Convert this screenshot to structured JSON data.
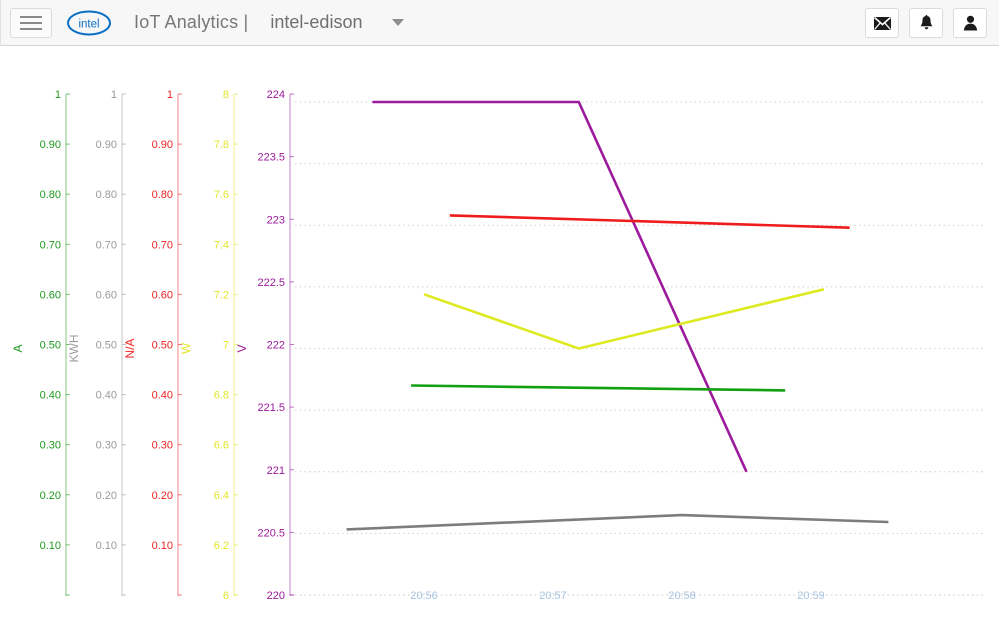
{
  "header": {
    "menu_icon": "hamburger-menu-icon",
    "logo_text": "intel",
    "app_title": "IoT Analytics |",
    "device_name": "intel-edison",
    "caret_icon": "chevron-down-icon",
    "actions": [
      {
        "name": "messages-button",
        "icon": "envelope-icon",
        "glyph": "✉"
      },
      {
        "name": "notifications-button",
        "icon": "bell-icon",
        "glyph": "🔔"
      },
      {
        "name": "account-button",
        "icon": "person-icon",
        "glyph": "👤"
      }
    ]
  },
  "chart_data": {
    "type": "line",
    "title": "",
    "xlabel": "",
    "grid": true,
    "legend": "none",
    "x_axis": {
      "ticks": [
        "20:56",
        "20:57",
        "20:58",
        "20:59"
      ],
      "tick_color": "#a8c4e0",
      "range": [
        "20:55",
        "21:00"
      ]
    },
    "y_axes": [
      {
        "label": "A",
        "color": "#1f9b1f",
        "ticks": [
          "1",
          "0.90",
          "0.80",
          "0.70",
          "0.60",
          "0.50",
          "0.40",
          "0.30",
          "0.20",
          "0.10"
        ],
        "min": 0,
        "max": 1
      },
      {
        "label": "KWH",
        "color": "#9a9a9a",
        "ticks": [
          "1",
          "0.90",
          "0.80",
          "0.70",
          "0.60",
          "0.50",
          "0.40",
          "0.30",
          "0.20",
          "0.10"
        ],
        "min": 0,
        "max": 1
      },
      {
        "label": "N/A",
        "color": "#ef2323",
        "ticks": [
          "1",
          "0.90",
          "0.80",
          "0.70",
          "0.60",
          "0.50",
          "0.40",
          "0.30",
          "0.20",
          "0.10"
        ],
        "min": 0,
        "max": 1
      },
      {
        "label": "W",
        "color": "#e2e62a",
        "ticks": [
          "8",
          "7.8",
          "7.6",
          "7.4",
          "7.2",
          "7",
          "6.8",
          "6.6",
          "6.4",
          "6.2",
          "6"
        ],
        "min": 6,
        "max": 8
      },
      {
        "label": "V",
        "color": "#9c1a9c",
        "ticks": [
          "224",
          "223.5",
          "223",
          "222.5",
          "222",
          "221.5",
          "221",
          "220.5",
          "220"
        ],
        "min": 220,
        "max": 224
      }
    ],
    "series": [
      {
        "name": "V",
        "axis": "V",
        "color": "#9c1a9c",
        "x": [
          "20:55.6",
          "20:57.2",
          "20:58.5"
        ],
        "values": [
          224.0,
          224.0,
          221.0
        ]
      },
      {
        "name": "N/A",
        "axis": "N/A",
        "color": "#ee1c1c",
        "x": [
          "20:56.2",
          "20:59.3"
        ],
        "values": [
          0.77,
          0.745
        ]
      },
      {
        "name": "W",
        "axis": "W",
        "color": "#ddea22",
        "x": [
          "20:56.0",
          "20:57.2",
          "20:59.1"
        ],
        "values": [
          7.22,
          7.0,
          7.24
        ]
      },
      {
        "name": "A",
        "axis": "A",
        "color": "#11a011",
        "x": [
          "20:55.9",
          "20:58.8"
        ],
        "values": [
          0.425,
          0.415
        ]
      },
      {
        "name": "KWH",
        "axis": "KWH",
        "color": "#7d7d7d",
        "x": [
          "20:55.4",
          "20:58.0",
          "20:59.6"
        ],
        "values": [
          0.133,
          0.162,
          0.148
        ]
      }
    ]
  }
}
